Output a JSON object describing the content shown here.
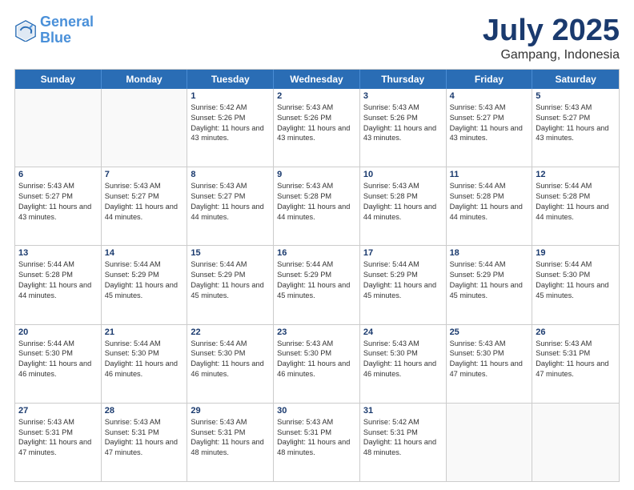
{
  "header": {
    "logo_text_general": "General",
    "logo_text_blue": "Blue",
    "month_title": "July 2025",
    "location": "Gampang, Indonesia"
  },
  "weekdays": [
    "Sunday",
    "Monday",
    "Tuesday",
    "Wednesday",
    "Thursday",
    "Friday",
    "Saturday"
  ],
  "rows": [
    [
      {
        "day": "",
        "sunrise": "",
        "sunset": "",
        "daylight": ""
      },
      {
        "day": "",
        "sunrise": "",
        "sunset": "",
        "daylight": ""
      },
      {
        "day": "1",
        "sunrise": "Sunrise: 5:42 AM",
        "sunset": "Sunset: 5:26 PM",
        "daylight": "Daylight: 11 hours and 43 minutes."
      },
      {
        "day": "2",
        "sunrise": "Sunrise: 5:43 AM",
        "sunset": "Sunset: 5:26 PM",
        "daylight": "Daylight: 11 hours and 43 minutes."
      },
      {
        "day": "3",
        "sunrise": "Sunrise: 5:43 AM",
        "sunset": "Sunset: 5:26 PM",
        "daylight": "Daylight: 11 hours and 43 minutes."
      },
      {
        "day": "4",
        "sunrise": "Sunrise: 5:43 AM",
        "sunset": "Sunset: 5:27 PM",
        "daylight": "Daylight: 11 hours and 43 minutes."
      },
      {
        "day": "5",
        "sunrise": "Sunrise: 5:43 AM",
        "sunset": "Sunset: 5:27 PM",
        "daylight": "Daylight: 11 hours and 43 minutes."
      }
    ],
    [
      {
        "day": "6",
        "sunrise": "Sunrise: 5:43 AM",
        "sunset": "Sunset: 5:27 PM",
        "daylight": "Daylight: 11 hours and 43 minutes."
      },
      {
        "day": "7",
        "sunrise": "Sunrise: 5:43 AM",
        "sunset": "Sunset: 5:27 PM",
        "daylight": "Daylight: 11 hours and 44 minutes."
      },
      {
        "day": "8",
        "sunrise": "Sunrise: 5:43 AM",
        "sunset": "Sunset: 5:27 PM",
        "daylight": "Daylight: 11 hours and 44 minutes."
      },
      {
        "day": "9",
        "sunrise": "Sunrise: 5:43 AM",
        "sunset": "Sunset: 5:28 PM",
        "daylight": "Daylight: 11 hours and 44 minutes."
      },
      {
        "day": "10",
        "sunrise": "Sunrise: 5:43 AM",
        "sunset": "Sunset: 5:28 PM",
        "daylight": "Daylight: 11 hours and 44 minutes."
      },
      {
        "day": "11",
        "sunrise": "Sunrise: 5:44 AM",
        "sunset": "Sunset: 5:28 PM",
        "daylight": "Daylight: 11 hours and 44 minutes."
      },
      {
        "day": "12",
        "sunrise": "Sunrise: 5:44 AM",
        "sunset": "Sunset: 5:28 PM",
        "daylight": "Daylight: 11 hours and 44 minutes."
      }
    ],
    [
      {
        "day": "13",
        "sunrise": "Sunrise: 5:44 AM",
        "sunset": "Sunset: 5:28 PM",
        "daylight": "Daylight: 11 hours and 44 minutes."
      },
      {
        "day": "14",
        "sunrise": "Sunrise: 5:44 AM",
        "sunset": "Sunset: 5:29 PM",
        "daylight": "Daylight: 11 hours and 45 minutes."
      },
      {
        "day": "15",
        "sunrise": "Sunrise: 5:44 AM",
        "sunset": "Sunset: 5:29 PM",
        "daylight": "Daylight: 11 hours and 45 minutes."
      },
      {
        "day": "16",
        "sunrise": "Sunrise: 5:44 AM",
        "sunset": "Sunset: 5:29 PM",
        "daylight": "Daylight: 11 hours and 45 minutes."
      },
      {
        "day": "17",
        "sunrise": "Sunrise: 5:44 AM",
        "sunset": "Sunset: 5:29 PM",
        "daylight": "Daylight: 11 hours and 45 minutes."
      },
      {
        "day": "18",
        "sunrise": "Sunrise: 5:44 AM",
        "sunset": "Sunset: 5:29 PM",
        "daylight": "Daylight: 11 hours and 45 minutes."
      },
      {
        "day": "19",
        "sunrise": "Sunrise: 5:44 AM",
        "sunset": "Sunset: 5:30 PM",
        "daylight": "Daylight: 11 hours and 45 minutes."
      }
    ],
    [
      {
        "day": "20",
        "sunrise": "Sunrise: 5:44 AM",
        "sunset": "Sunset: 5:30 PM",
        "daylight": "Daylight: 11 hours and 46 minutes."
      },
      {
        "day": "21",
        "sunrise": "Sunrise: 5:44 AM",
        "sunset": "Sunset: 5:30 PM",
        "daylight": "Daylight: 11 hours and 46 minutes."
      },
      {
        "day": "22",
        "sunrise": "Sunrise: 5:44 AM",
        "sunset": "Sunset: 5:30 PM",
        "daylight": "Daylight: 11 hours and 46 minutes."
      },
      {
        "day": "23",
        "sunrise": "Sunrise: 5:43 AM",
        "sunset": "Sunset: 5:30 PM",
        "daylight": "Daylight: 11 hours and 46 minutes."
      },
      {
        "day": "24",
        "sunrise": "Sunrise: 5:43 AM",
        "sunset": "Sunset: 5:30 PM",
        "daylight": "Daylight: 11 hours and 46 minutes."
      },
      {
        "day": "25",
        "sunrise": "Sunrise: 5:43 AM",
        "sunset": "Sunset: 5:30 PM",
        "daylight": "Daylight: 11 hours and 47 minutes."
      },
      {
        "day": "26",
        "sunrise": "Sunrise: 5:43 AM",
        "sunset": "Sunset: 5:31 PM",
        "daylight": "Daylight: 11 hours and 47 minutes."
      }
    ],
    [
      {
        "day": "27",
        "sunrise": "Sunrise: 5:43 AM",
        "sunset": "Sunset: 5:31 PM",
        "daylight": "Daylight: 11 hours and 47 minutes."
      },
      {
        "day": "28",
        "sunrise": "Sunrise: 5:43 AM",
        "sunset": "Sunset: 5:31 PM",
        "daylight": "Daylight: 11 hours and 47 minutes."
      },
      {
        "day": "29",
        "sunrise": "Sunrise: 5:43 AM",
        "sunset": "Sunset: 5:31 PM",
        "daylight": "Daylight: 11 hours and 48 minutes."
      },
      {
        "day": "30",
        "sunrise": "Sunrise: 5:43 AM",
        "sunset": "Sunset: 5:31 PM",
        "daylight": "Daylight: 11 hours and 48 minutes."
      },
      {
        "day": "31",
        "sunrise": "Sunrise: 5:42 AM",
        "sunset": "Sunset: 5:31 PM",
        "daylight": "Daylight: 11 hours and 48 minutes."
      },
      {
        "day": "",
        "sunrise": "",
        "sunset": "",
        "daylight": ""
      },
      {
        "day": "",
        "sunrise": "",
        "sunset": "",
        "daylight": ""
      }
    ]
  ]
}
